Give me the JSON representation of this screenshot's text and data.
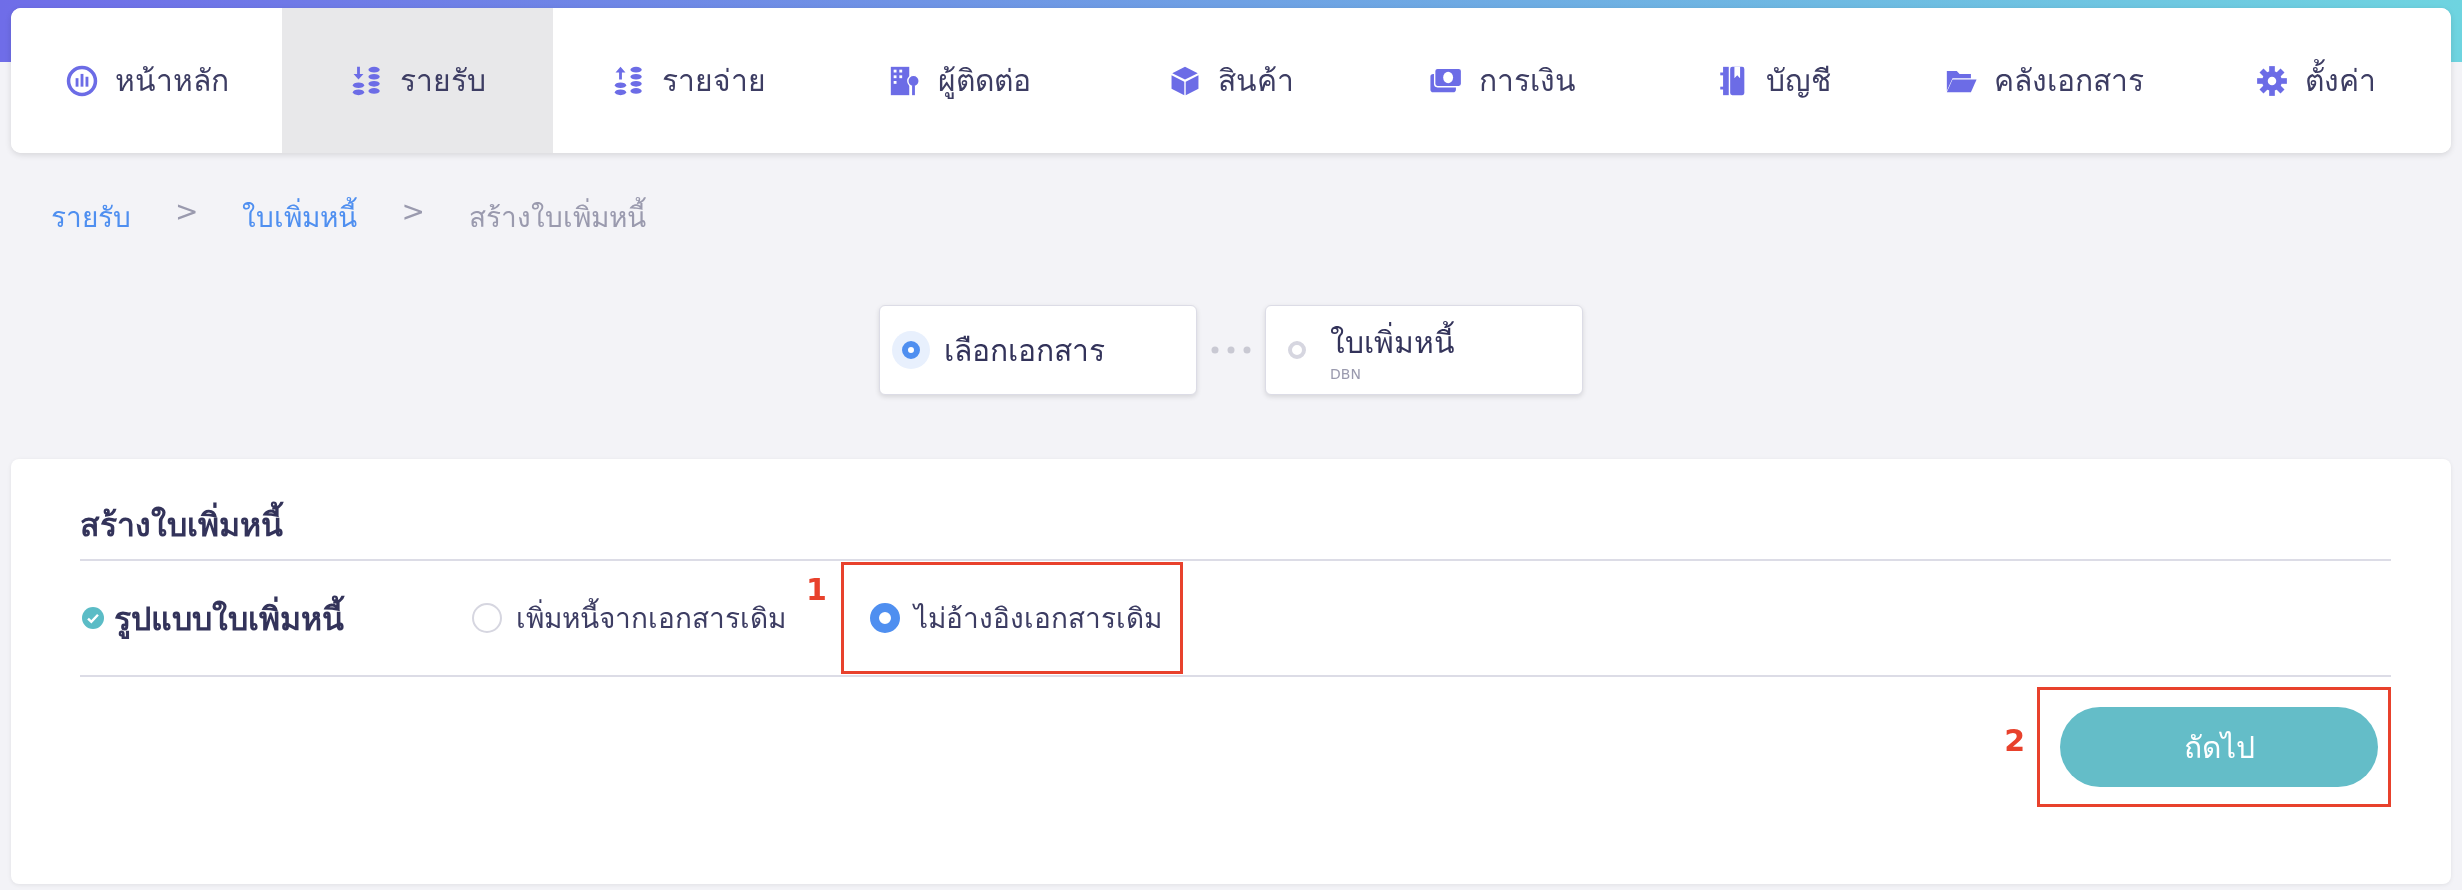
{
  "nav_tabs": [
    {
      "label": "หน้าหลัก",
      "selected": false
    },
    {
      "label": "รายรับ",
      "selected": true
    },
    {
      "label": "รายจ่าย",
      "selected": false
    },
    {
      "label": "ผู้ติดต่อ",
      "selected": false
    },
    {
      "label": "สินค้า",
      "selected": false
    },
    {
      "label": "การเงิน",
      "selected": false
    },
    {
      "label": "บัญชี",
      "selected": false
    },
    {
      "label": "คลังเอกสาร",
      "selected": false
    },
    {
      "label": "ตั้งค่า",
      "selected": false
    }
  ],
  "breadcrumb": [
    {
      "label": "รายรับ",
      "kind": "link"
    },
    {
      "label": ">",
      "kind": "separator"
    },
    {
      "label": "ใบเพิ่มหนี้",
      "kind": "link"
    },
    {
      "label": ">",
      "kind": "separator"
    },
    {
      "label": "สร้างใบเพิ่มหนี้",
      "kind": "current"
    }
  ],
  "steps": [
    {
      "label": "เลือกเอกสาร",
      "selected": true
    },
    {
      "label": "ใบเพิ่มหนี้",
      "sublabel": "DBN",
      "selected": false
    }
  ],
  "form": {
    "title": "สร้างใบเพิ่มหนี้",
    "field": {
      "label": "รูปแบบใบเพิ่มหนี้",
      "checked": true,
      "options": [
        {
          "label": "เพิ่มหนี้จากเอกสารเดิม",
          "selected": false
        },
        {
          "label": "ไม่อ้างอิงเอกสารเดิม",
          "selected": true,
          "annotation": "1"
        }
      ]
    },
    "next_button": {
      "label": "ถัดไป",
      "annotation": "2"
    }
  }
}
